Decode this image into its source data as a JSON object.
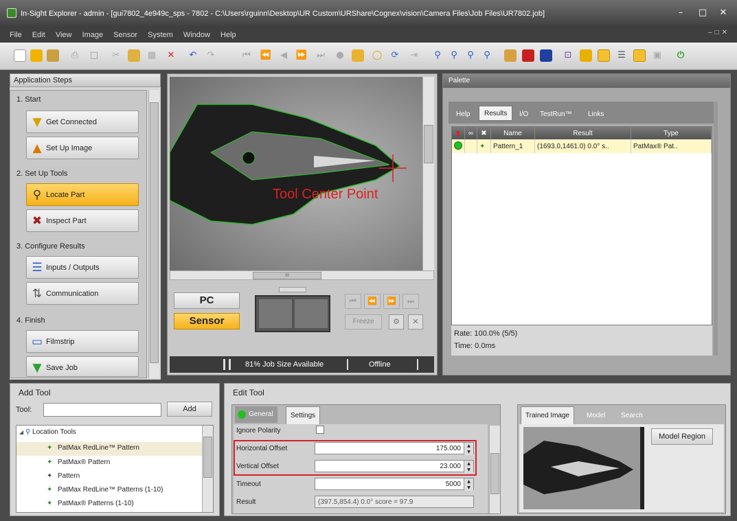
{
  "window": {
    "title": "In-Sight Explorer - admin - [gui7802_4e949c_sps - 7802 - C:\\Users\\rguinn\\Desktop\\UR Custom\\URShare\\Cognex\\vision\\Camera Files\\Job Files\\UR7802.job]"
  },
  "menu": [
    "File",
    "Edit",
    "View",
    "Image",
    "Sensor",
    "System",
    "Window",
    "Help"
  ],
  "application_steps": {
    "title": "Application Steps",
    "sections": [
      {
        "header": "1. Start",
        "items": [
          "Get Connected",
          "Set Up Image"
        ]
      },
      {
        "header": "2. Set Up Tools",
        "items": [
          "Locate Part",
          "Inspect Part"
        ]
      },
      {
        "header": "3. Configure Results",
        "items": [
          "Inputs / Outputs",
          "Communication"
        ]
      },
      {
        "header": "4. Finish",
        "items": [
          "Filmstrip",
          "Save Job"
        ]
      }
    ]
  },
  "image_view": {
    "annotation": "Tool Center Point",
    "pc_label": "PC",
    "sensor_label": "Sensor",
    "freeze_label": "Freeze",
    "status_job_size": "81% Job Size Available",
    "status_online": "Offline",
    "scroll_mark": "III"
  },
  "palette": {
    "title": "Palette",
    "tabs": [
      "Help",
      "Results",
      "I/O",
      "TestRun™",
      "Links"
    ],
    "columns": [
      "Name",
      "Result",
      "Type"
    ],
    "rows": [
      {
        "name": "Pattern_1",
        "result": "(1693.0,1461.0) 0.0° s..",
        "type": "PatMax® Pat.."
      }
    ],
    "rate": "Rate: 100.0% (5/5)",
    "time": "Time: 0.0ms"
  },
  "add_tool": {
    "title": "Add Tool",
    "tool_label": "Tool:",
    "tool_value": "",
    "add_button": "Add",
    "tree_root": "Location Tools",
    "tree_items": [
      "PatMax RedLine™ Pattern",
      "PatMax® Pattern",
      "Pattern",
      "PatMax RedLine™ Patterns (1-10)",
      "PatMax® Patterns (1-10)"
    ]
  },
  "edit_tool": {
    "title": "Edit Tool",
    "tabs": [
      "General",
      "Settings"
    ],
    "fields": [
      {
        "label": "Ignore Polarity",
        "value": ""
      },
      {
        "label": "Horizontal Offset",
        "value": "175.000"
      },
      {
        "label": "Vertical Offset",
        "value": "23.000"
      },
      {
        "label": "Timeout",
        "value": "5000"
      },
      {
        "label": "Result",
        "value": "(397.5,854.4) 0.0° score = 97.9"
      }
    ],
    "model_tabs": [
      "Trained Image",
      "Model",
      "Search"
    ],
    "model_region_button": "Model Region"
  },
  "colors": {
    "highlight_red": "#d8202a",
    "active_step": "#f6b21b",
    "pass_green": "#22c022"
  }
}
